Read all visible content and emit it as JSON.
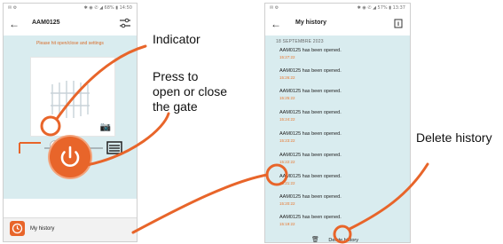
{
  "screen1": {
    "status_left": "✉ ⚙",
    "status_right": "✱ ◉ ✆ ◢ 68% ▮ 14:50",
    "title": "AAM0125",
    "banner": "Please hit open/close and settings",
    "history_label": "My history"
  },
  "screen2": {
    "status_left": "✉ ⚙",
    "status_right": "✱ ◉ ✆ ◢ 57% ▮ 13:37",
    "title": "My history",
    "date_header": "18 SEPTEMBRE 2023",
    "entries": [
      {
        "text": "AAM0125 has been opened.",
        "time": "15:27:22"
      },
      {
        "text": "AAM0125 has been opened.",
        "time": "15:26:22"
      },
      {
        "text": "AAM0125 has been opened.",
        "time": "15:25:22"
      },
      {
        "text": "AAM0125 has been opened.",
        "time": "15:24:22"
      },
      {
        "text": "AAM0125 has been opened.",
        "time": "15:23:22"
      },
      {
        "text": "AAM0125 has been opened.",
        "time": "15:22:22"
      },
      {
        "text": "AAM0125 has been opened.",
        "time": "15:21:22"
      },
      {
        "text": "AAM0125 has been opened.",
        "time": "15:20:22"
      },
      {
        "text": "AAM0125 has been opened.",
        "time": "15:19:22"
      }
    ],
    "delete_label": "Delete history"
  },
  "callouts": {
    "indicator": "Indicator",
    "press_line1": "Press to",
    "press_line2": "open or close",
    "press_line3": "the gate",
    "delete_history": "Delete history"
  },
  "colors": {
    "accent": "#e8652a",
    "panel": "#d9ecef"
  }
}
